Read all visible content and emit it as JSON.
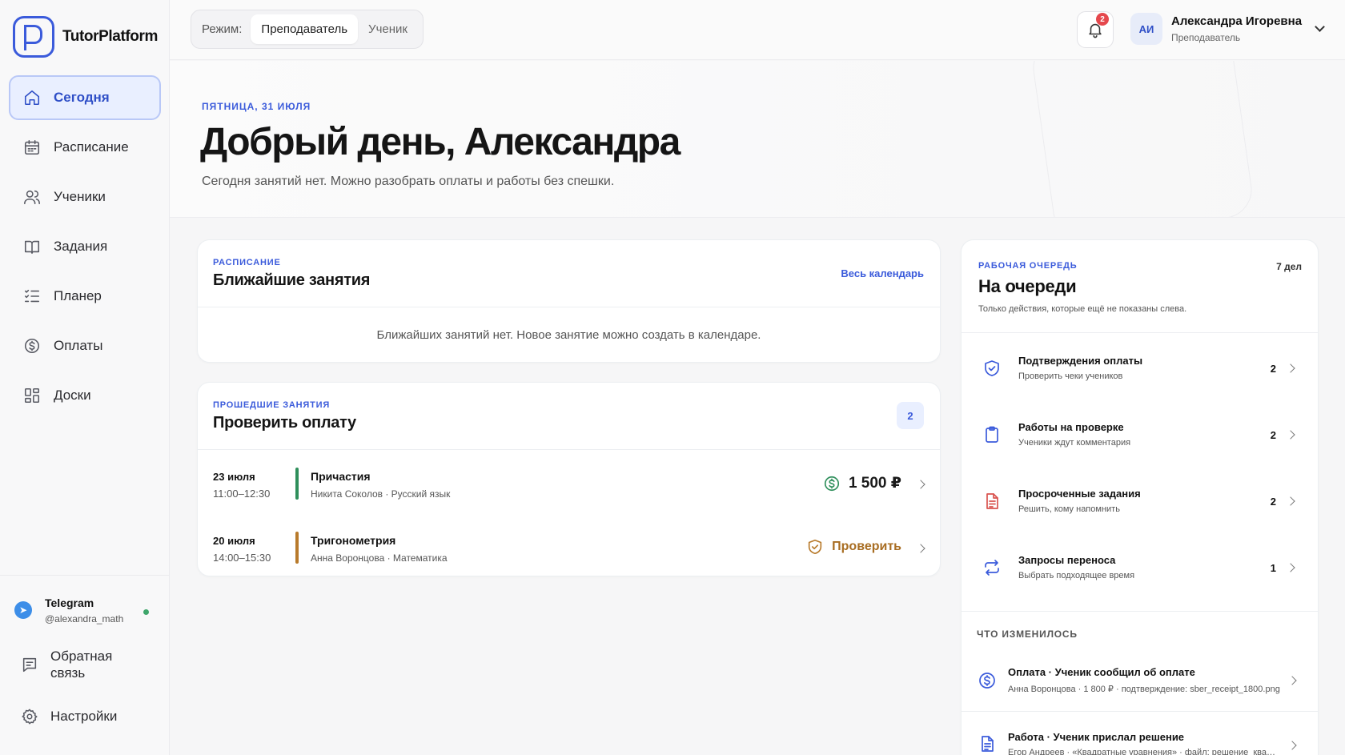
{
  "app": {
    "name": "TutorPlatform"
  },
  "nav": {
    "items": [
      {
        "label": "Сегодня",
        "icon": "home-icon",
        "active": true
      },
      {
        "label": "Расписание",
        "icon": "calendar-icon"
      },
      {
        "label": "Ученики",
        "icon": "users-icon"
      },
      {
        "label": "Задания",
        "icon": "book-icon"
      },
      {
        "label": "Планер",
        "icon": "checklist-icon"
      },
      {
        "label": "Оплаты",
        "icon": "dollar-icon"
      },
      {
        "label": "Доски",
        "icon": "grid-icon"
      }
    ]
  },
  "sidebar_bottom": {
    "telegram_name": "Telegram",
    "telegram_handle": "@alexandra_math",
    "feedback_label": "Обратная связь",
    "settings_label": "Настройки"
  },
  "topbar": {
    "mode_label": "Режим:",
    "mode_teacher": "Преподаватель",
    "mode_student": "Ученик",
    "notifications_count": "2",
    "user_initials": "АИ",
    "user_name": "Александра Игоревна",
    "user_role": "Преподаватель"
  },
  "hero": {
    "date": "ПЯТНИЦА, 31 ИЮЛЯ",
    "title": "Добрый день, Александра",
    "subtitle": "Сегодня занятий нет. Можно разобрать оплаты и работы без спешки."
  },
  "schedule": {
    "kicker": "РАСПИСАНИЕ",
    "title": "Ближайшие занятия",
    "link": "Весь календарь",
    "empty": "Ближайших занятий нет. Новое занятие можно создать в календаре."
  },
  "past": {
    "kicker": "ПРОШЕДШИЕ ЗАНЯТИЯ",
    "title": "Проверить оплату",
    "count": "2",
    "lessons": [
      {
        "date": "23 июля",
        "time": "11:00–12:30",
        "title": "Причастия",
        "meta": "Никита Соколов · Русский язык",
        "action": "1 500 ₽",
        "color": "#2f8f5b"
      },
      {
        "date": "20 июля",
        "time": "14:00–15:30",
        "title": "Тригонометрия",
        "meta": "Анна Воронцова · Математика",
        "action": "Проверить",
        "color": "#b87a2b"
      }
    ]
  },
  "queue": {
    "kicker": "РАБОЧАЯ ОЧЕРЕДЬ",
    "count": "7 дел",
    "title": "На очереди",
    "note": "Только действия, которые ещё не показаны слева.",
    "items": [
      {
        "title": "Подтверждения оплаты",
        "sub": "Проверить чеки учеников",
        "num": "2",
        "icon": "shield-check-icon"
      },
      {
        "title": "Работы на проверке",
        "sub": "Ученики ждут комментария",
        "num": "2",
        "icon": "clipboard-icon"
      },
      {
        "title": "Просроченные задания",
        "sub": "Решить, кому напомнить",
        "num": "2",
        "icon": "document-icon"
      },
      {
        "title": "Запросы переноса",
        "sub": "Выбрать подходящее время",
        "num": "1",
        "icon": "repeat-icon"
      }
    ]
  },
  "changes": {
    "heading": "ЧТО ИЗМЕНИЛОСЬ",
    "items": [
      {
        "title": "Оплата · Ученик сообщил об оплате",
        "sub": "Анна Воронцова · 1 800 ₽ · подтверждение: sber_receipt_1800.png",
        "icon": "dollar-icon"
      },
      {
        "title": "Работа · Ученик прислал решение",
        "sub": "Егор Андреев · «Квадратные уравнения» · файл: решение_квадратные.pdf",
        "icon": "document-icon"
      }
    ]
  },
  "colors": {
    "accent": "#3b5bdb",
    "danger": "#e5484d",
    "success": "#2f8f5b",
    "warning": "#b87a2b"
  }
}
